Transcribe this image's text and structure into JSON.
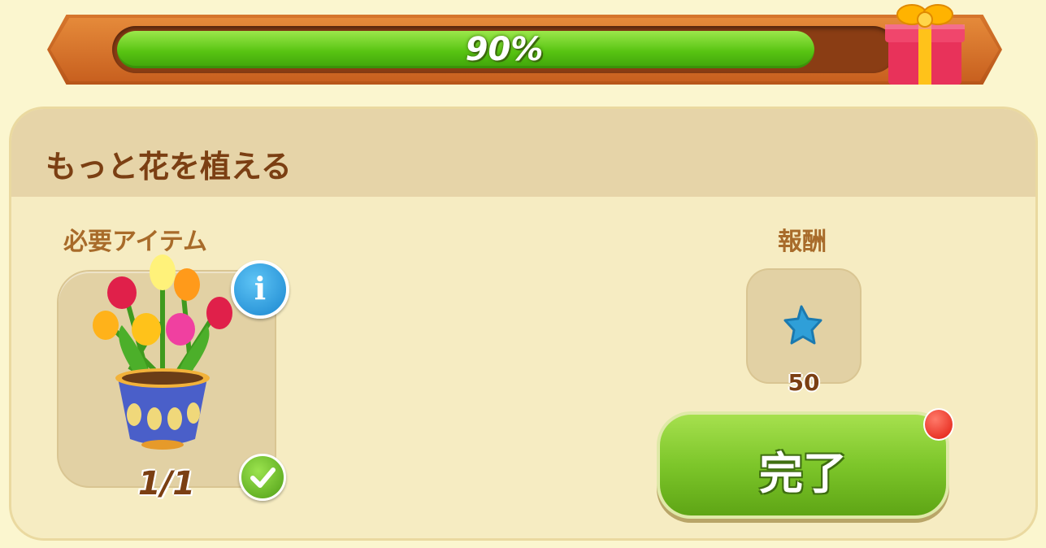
{
  "progress": {
    "value": 0.9,
    "label": "90%"
  },
  "quest": {
    "title": "もっと花を植える"
  },
  "required": {
    "label": "必要アイテム",
    "item_icon": "tulip-pot-icon",
    "count": "1/1",
    "info_icon": "info-icon",
    "check_icon": "checkmark-icon"
  },
  "reward": {
    "label": "報酬",
    "icon": "blue-star-icon",
    "amount": "50"
  },
  "actions": {
    "complete_label": "完了"
  },
  "colors": {
    "title": "#7b3f13",
    "progress_fill": "#58c412",
    "button_green": "#7dc62a",
    "notify_red": "#e11a0e"
  }
}
